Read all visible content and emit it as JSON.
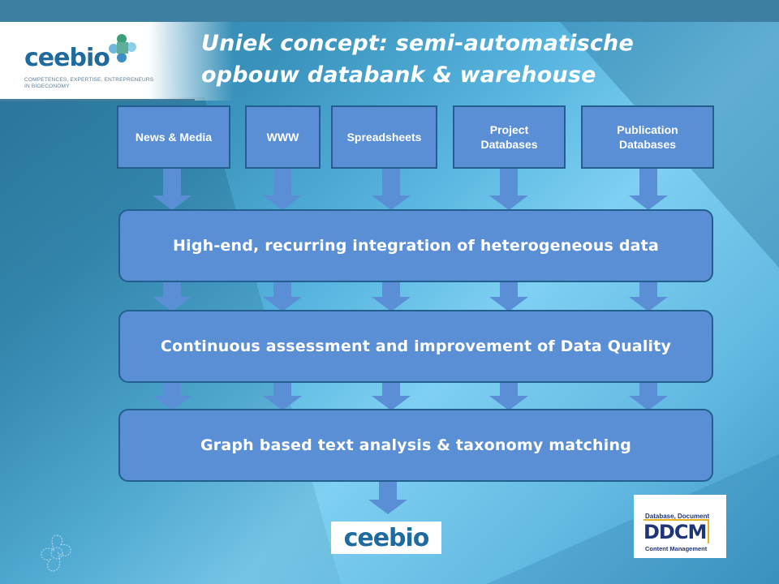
{
  "slide": {
    "title_line1": "Uniek concept: semi-automatische",
    "title_line2": "opbouw databank & warehouse"
  },
  "logo": {
    "wordmark": "ceebio",
    "tagline_line1": "COMPETENCES, EXPERTISE, ENTREPRENEURS",
    "tagline_line2": "IN BIOECONOMY"
  },
  "sources": [
    {
      "label": "News & Media"
    },
    {
      "label": "WWW"
    },
    {
      "label": "Spreadsheets"
    },
    {
      "label": "Project Databases"
    },
    {
      "label": "Publication Databases"
    }
  ],
  "stages": [
    {
      "label": "High-end, recurring integration of heterogeneous data"
    },
    {
      "label": "Continuous assessment and improvement of Data Quality"
    },
    {
      "label": "Graph based text analysis & taxonomy matching"
    }
  ],
  "outputs": {
    "ceebio_logo": "ceebio",
    "ddcm_top": "Database, Document",
    "ddcm_main": "DDCM",
    "ddcm_bottom": "Content Management"
  },
  "colors": {
    "box_fill": "#5a8fd6",
    "box_border": "#235f8e",
    "arrow": "#5a8fd6",
    "brand": "#1f6a9e"
  }
}
